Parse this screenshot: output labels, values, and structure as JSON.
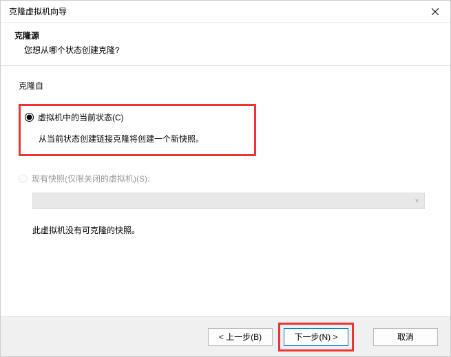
{
  "window": {
    "title": "克隆虚拟机向导"
  },
  "header": {
    "title": "克隆源",
    "subtitle": "您想从哪个状态创建克隆?"
  },
  "group_label": "克隆自",
  "option_current": {
    "label": "虚拟机中的当前状态(C)",
    "desc": "从当前状态创建链接克隆将创建一个新快照。"
  },
  "option_snapshot": {
    "label": "现有快照(仅限关闭的虚拟机)(S):",
    "msg": "此虚拟机没有可克隆的快照。"
  },
  "buttons": {
    "back": "< 上一步(B)",
    "next": "下一步(N) >",
    "cancel": "取消"
  }
}
